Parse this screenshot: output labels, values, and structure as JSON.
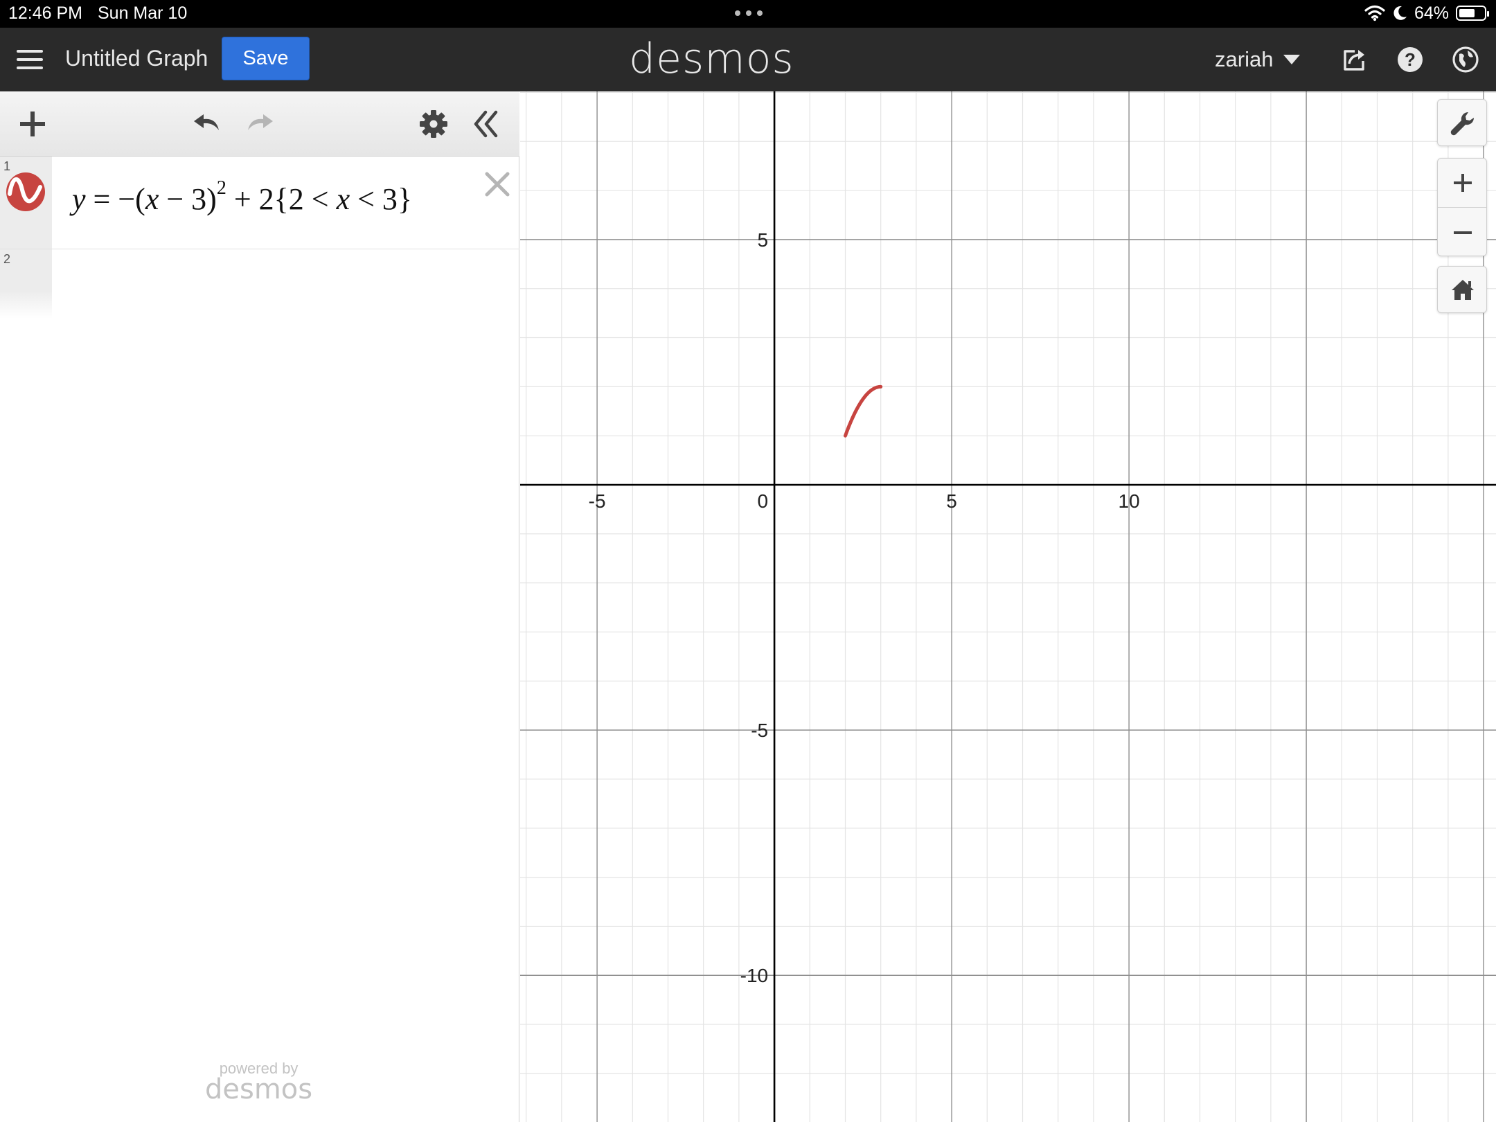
{
  "status_bar": {
    "time": "12:46 PM",
    "date": "Sun Mar 10",
    "battery_percent": "64%",
    "battery_level": 0.64
  },
  "header": {
    "menu_icon": "hamburger-menu-icon",
    "graph_title": "Untitled Graph",
    "save_label": "Save",
    "logo": "desmos",
    "username": "zariah",
    "icons": [
      "share-icon",
      "help-icon",
      "globe-icon"
    ]
  },
  "expression_panel": {
    "toolbar": {
      "icons": [
        "add-icon",
        "undo-icon",
        "redo-icon",
        "settings-gear-icon",
        "collapse-chevrons-icon"
      ]
    },
    "expressions": [
      {
        "index": "1",
        "color": "#c74440",
        "formula": {
          "lhs": "y",
          "eq": " = −(",
          "var1": "x",
          "mid": " − 3)",
          "exp": "2",
          "rest": " + 2{2 < ",
          "var2": "x",
          "end": " < 3}"
        }
      },
      {
        "index": "2"
      }
    ],
    "footer": {
      "powered_by": "powered by",
      "brand": "desmos"
    }
  },
  "graph": {
    "x_ticks": [
      "-5",
      "0",
      "5",
      "10"
    ],
    "y_ticks": [
      "5",
      "-5",
      "-10"
    ],
    "x_range": [
      -7.17,
      20.35
    ],
    "y_range": [
      -12.99,
      8.02
    ],
    "grid_major_step": 5,
    "grid_minor_step": 1,
    "curve": {
      "color": "#c74440",
      "function": "y = -(x-3)^2 + 2",
      "domain": [
        2,
        3
      ]
    }
  },
  "graph_tools": {
    "icons": [
      "wrench-icon",
      "zoom-in-icon",
      "zoom-out-icon",
      "home-icon"
    ]
  }
}
